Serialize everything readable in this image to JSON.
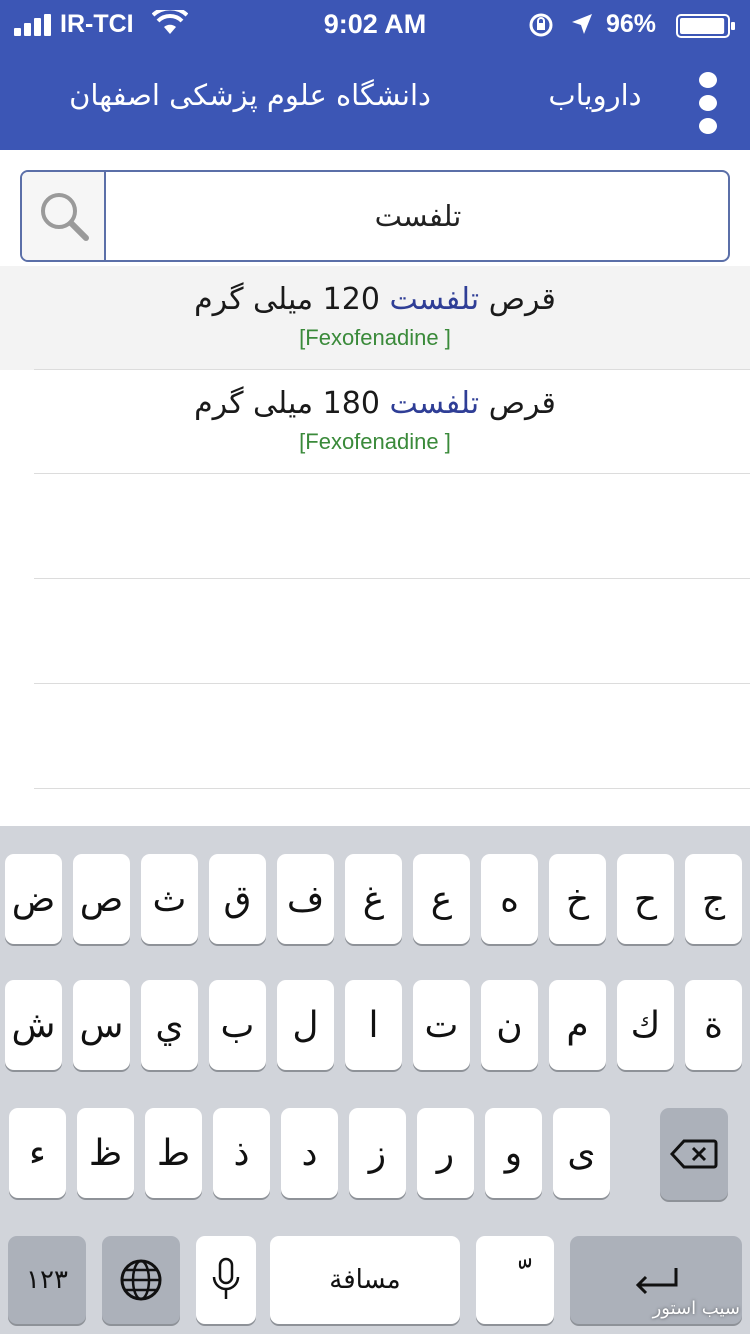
{
  "status_bar": {
    "carrier": "IR-TCI",
    "time": "9:02 AM",
    "battery_percent": "96%",
    "battery_level": 0.96,
    "icons": [
      "signal-icon",
      "wifi-icon",
      "orientation-lock-icon",
      "location-arrow-icon",
      "battery-icon"
    ]
  },
  "app_bar": {
    "title": "دارویاب",
    "subtitle": "دانشگاه علوم پزشکی اصفهان",
    "menu_icon": "more-vert-icon",
    "color": "#3c56b5"
  },
  "search": {
    "value": "تلفست",
    "icon": "search-icon"
  },
  "results": [
    {
      "prefix": "قرص",
      "highlight": "تلفست",
      "suffix": "120 میلی گرم",
      "generic": "[Fexofenadine ]"
    },
    {
      "prefix": "قرص",
      "highlight": "تلفست",
      "suffix": "180 میلی گرم",
      "generic": "[Fexofenadine ]"
    }
  ],
  "keyboard": {
    "rows": [
      [
        "ج",
        "ح",
        "خ",
        "ه",
        "ع",
        "غ",
        "ف",
        "ق",
        "ث",
        "ص",
        "ض"
      ],
      [
        "ة",
        "ك",
        "م",
        "ن",
        "ت",
        "ا",
        "ل",
        "ب",
        "ي",
        "س",
        "ش"
      ],
      [
        "ى",
        "و",
        "ر",
        "ز",
        "د",
        "ذ",
        "ط",
        "ظ",
        "ء"
      ]
    ],
    "numbers_key": "١٢٣",
    "space_key": "مسافة",
    "diacritic_key": "ّ",
    "icons": [
      "backspace-icon",
      "globe-icon",
      "microphone-icon",
      "return-icon"
    ]
  },
  "watermark": "سیب استور",
  "colors": {
    "result_highlight": "#2f3e96",
    "generic_name": "#3a8a3a",
    "keyboard_bg": "#d1d4da"
  }
}
